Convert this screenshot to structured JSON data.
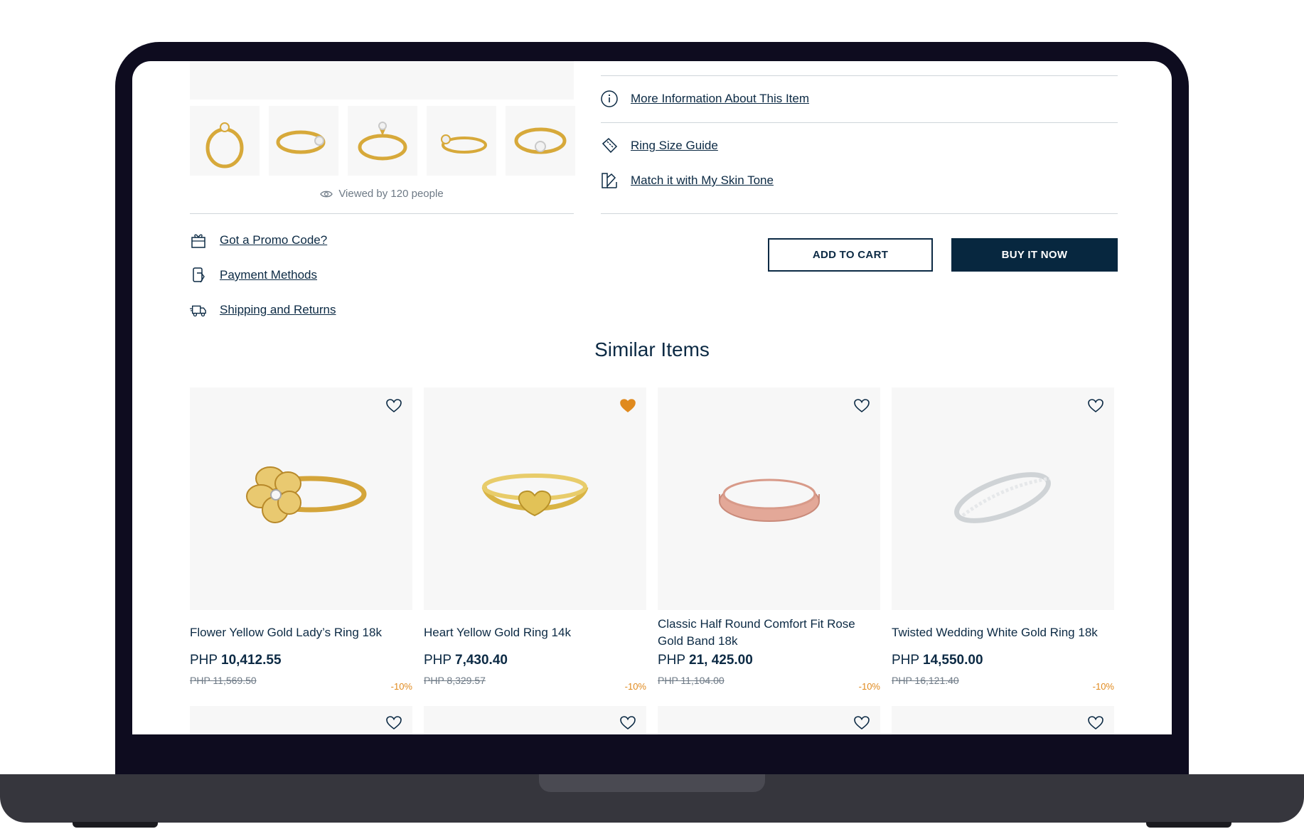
{
  "gallery": {
    "viewed_text": "Viewed by 120 people",
    "thumbnails": [
      "ring-front-view",
      "ring-side-view",
      "ring-angle-view",
      "ring-top-view",
      "ring-closeup-view"
    ]
  },
  "info_links": {
    "more_info": "More Information About This Item",
    "ring_size": "Ring Size Guide",
    "skin_tone": "Match it with My Skin Tone"
  },
  "side_links": {
    "promo": "Got a Promo Code?",
    "payment": "Payment Methods",
    "shipping": "Shipping and Returns"
  },
  "actions": {
    "add_to_cart": "ADD TO CART",
    "buy_now": "BUY IT NOW"
  },
  "similar": {
    "title": "Similar Items",
    "items": [
      {
        "name": "Flower Yellow Gold Lady’s Ring 18k",
        "currency": "PHP",
        "price": "10,412.55",
        "old_price": "PHP 11,569.50",
        "discount": "-10%",
        "favorited": false,
        "image": "flower-ring"
      },
      {
        "name": "Heart Yellow Gold Ring 14k",
        "currency": "PHP",
        "price": "7,430.40",
        "old_price": "PHP 8,329.57",
        "discount": "-10%",
        "favorited": true,
        "image": "heart-ring"
      },
      {
        "name": "Classic Half Round Comfort Fit Rose Gold Band 18k",
        "currency": "PHP",
        "price": "21, 425.00",
        "old_price": "PHP 11,104.00",
        "discount": "-10%",
        "favorited": false,
        "image": "rose-band"
      },
      {
        "name": "Twisted Wedding White Gold Ring 18k",
        "currency": "PHP",
        "price": "14,550.00",
        "old_price": "PHP 16,121.40",
        "discount": "-10%",
        "favorited": false,
        "image": "twisted-ring"
      }
    ]
  },
  "colors": {
    "navy": "#07273f",
    "accent_orange": "#e08a1e",
    "text_muted": "#6e7a86"
  }
}
